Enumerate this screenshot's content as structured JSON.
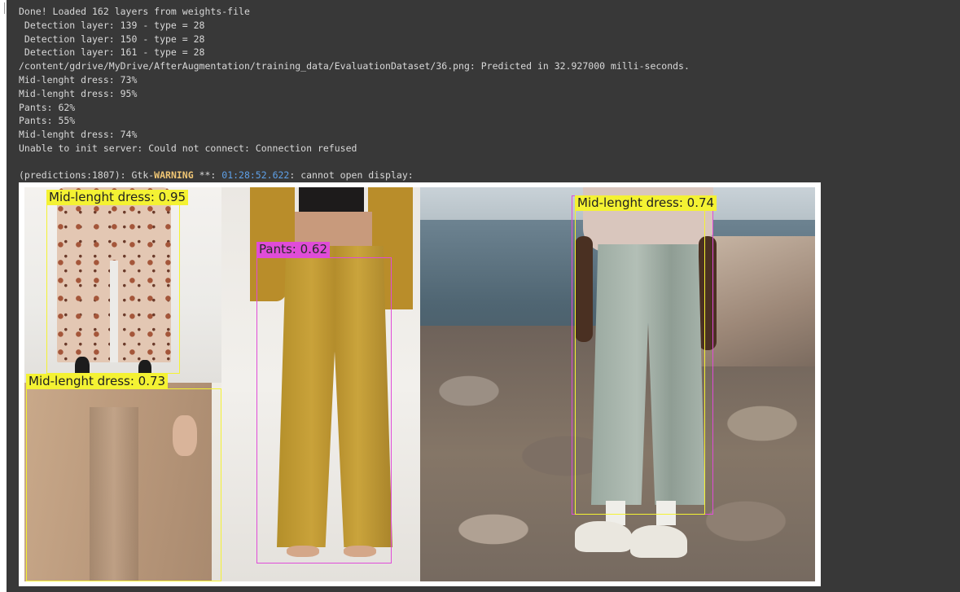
{
  "console": {
    "log_lines": [
      "Done! Loaded 162 layers from weights-file",
      " Detection layer: 139 - type = 28",
      " Detection layer: 150 - type = 28",
      " Detection layer: 161 - type = 28",
      "/content/gdrive/MyDrive/AfterAugmentation/training_data/EvaluationDataset/36.png: Predicted in 32.927000 milli-seconds.",
      "Mid-lenght dress: 73%",
      "Mid-lenght dress: 95%",
      "Pants: 62%",
      "Pants: 55%",
      "Mid-lenght dress: 74%",
      "Unable to init server: Could not connect: Connection refused"
    ],
    "warning": {
      "prefix": "(predictions:1807): Gtk-",
      "level": "WARNING",
      "stars": " **: ",
      "time": "01:28:52.622",
      "message": ": cannot open display:"
    }
  },
  "detections": {
    "dress_095": "Mid-lenght dress: 0.95",
    "dress_073": "Mid-lenght dress: 0.73",
    "pants_062": "Pants: 0.62",
    "dress_074": "Mid-lenght dress: 0.74"
  },
  "colors": {
    "background": "#383838",
    "text": "#d8d8d8",
    "warning": "#f0c674",
    "timestamp": "#5ea0e8",
    "dress_box": "#f4f233",
    "pants_box": "#e04cd8"
  }
}
